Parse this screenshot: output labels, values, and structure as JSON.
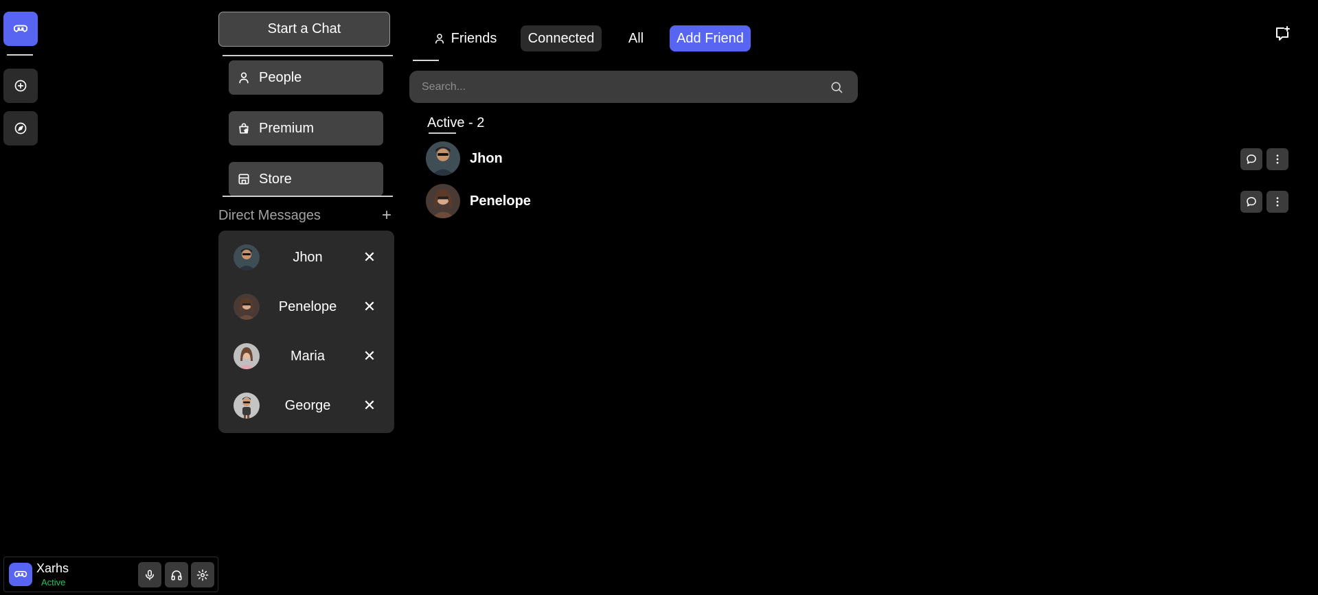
{
  "rail": {
    "home_icon": "controller-icon",
    "add_icon": "plus-circle-icon",
    "explore_icon": "compass-icon",
    "accent": "#5865f2"
  },
  "sidebar": {
    "start_chat_label": "Start a Chat",
    "nav": [
      {
        "label": "People",
        "icon": "person-icon"
      },
      {
        "label": "Premium",
        "icon": "shopping-bag-star-icon"
      },
      {
        "label": "Store",
        "icon": "store-icon"
      }
    ],
    "dm_header": "Direct Messages",
    "dm_add": "+",
    "dms": [
      {
        "name": "Jhon",
        "close": "✕"
      },
      {
        "name": "Penelope",
        "close": "✕"
      },
      {
        "name": "Maria",
        "close": "✕"
      },
      {
        "name": "George",
        "close": "✕"
      }
    ]
  },
  "user": {
    "name": "Xarhs",
    "status": "Active",
    "status_color": "#22c55e"
  },
  "tabs": {
    "friends": "Friends",
    "connected": "Connected",
    "all": "All",
    "add_friend": "Add Friend"
  },
  "search": {
    "placeholder": "Search..."
  },
  "friends": {
    "active_label": "Active - 2",
    "rows": [
      {
        "name": "Jhon"
      },
      {
        "name": "Penelope"
      }
    ]
  }
}
